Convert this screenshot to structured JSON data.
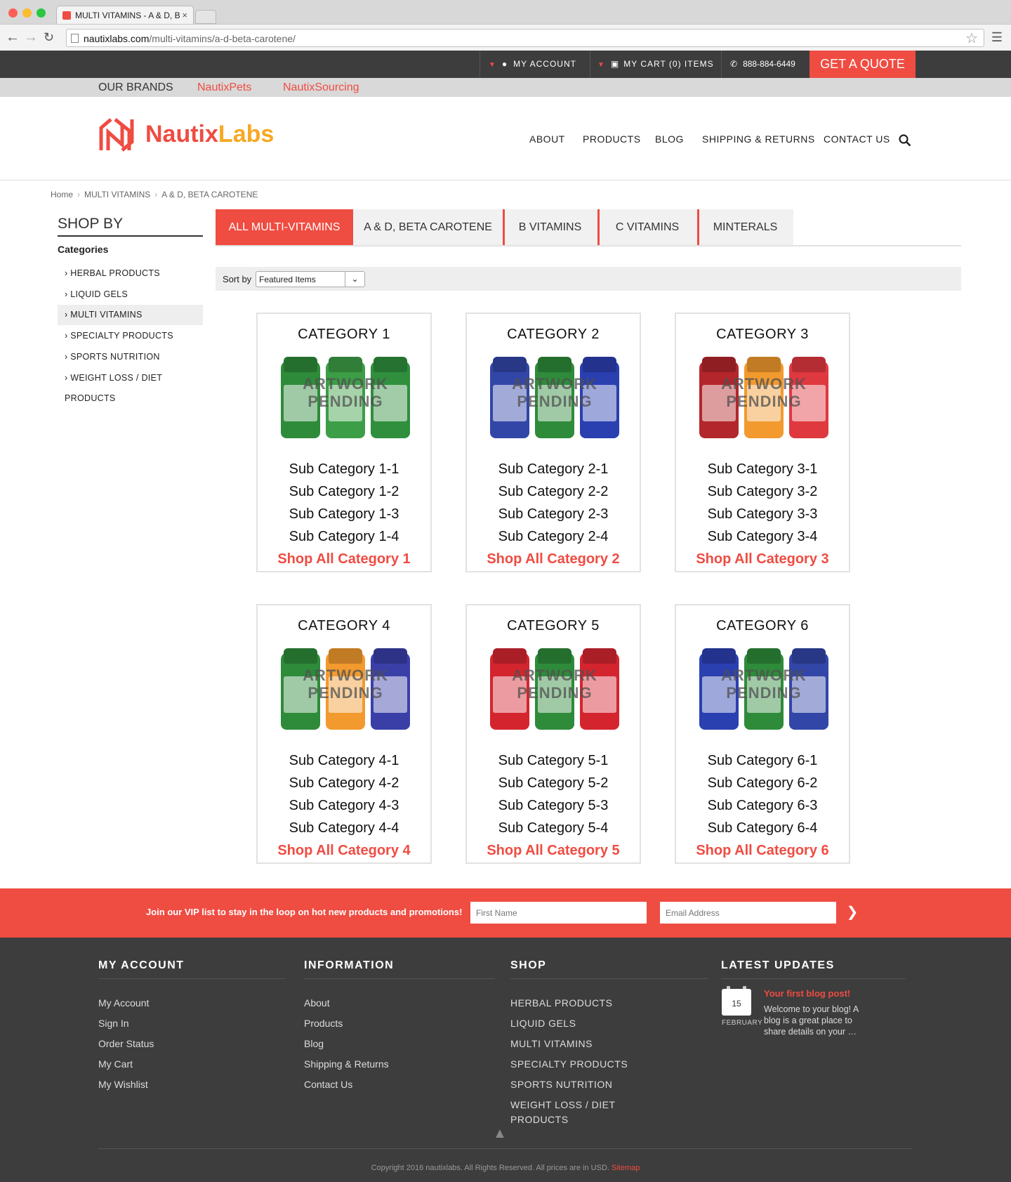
{
  "browser": {
    "tab_title": "MULTI VITAMINS - A & D, B",
    "tab_close": "×",
    "url_host": "nautixlabs.com",
    "url_path": "/multi-vitamins/a-d-beta-carotene/"
  },
  "topbar": {
    "account": "MY ACCOUNT",
    "cart": "MY CART (0) ITEMS",
    "phone": "888-884-6449",
    "quote": "GET A QUOTE"
  },
  "brands": {
    "label": "OUR BRANDS",
    "links": [
      "NautixPets",
      "NautixSourcing"
    ]
  },
  "logo": {
    "part1": "Nautix",
    "part2": "Labs"
  },
  "nav": [
    "ABOUT",
    "PRODUCTS",
    "BLOG",
    "SHIPPING & RETURNS",
    "CONTACT US"
  ],
  "breadcrumb": [
    "Home",
    "MULTI VITAMINS",
    "A & D, BETA CAROTENE"
  ],
  "sidebar": {
    "title": "SHOP BY",
    "heading": "Categories",
    "items": [
      "HERBAL PRODUCTS",
      "LIQUID GELS",
      "MULTI VITAMINS",
      "SPECIALTY PRODUCTS",
      "SPORTS NUTRITION",
      "WEIGHT LOSS / DIET PRODUCTS"
    ]
  },
  "tabs": [
    "ALL MULTI-VITAMINS",
    "A & D, BETA CAROTENE",
    "B VITAMINS",
    "C VITAMINS",
    "MINTERALS"
  ],
  "sort": {
    "label": "Sort by",
    "selected": "Featured Items"
  },
  "artwork_label": [
    "ARTWORK",
    "PENDING"
  ],
  "cards": [
    {
      "title": "CATEGORY 1",
      "subs": [
        "Sub Category 1-1",
        "Sub Category 1-2",
        "Sub Category 1-3",
        "Sub Category 1-4"
      ],
      "shop_all": "Shop All Category 1",
      "colors": [
        "#2e8b3a",
        "#3c9e46",
        "#2f8f3d"
      ]
    },
    {
      "title": "CATEGORY 2",
      "subs": [
        "Sub Category 2-1",
        "Sub Category 2-2",
        "Sub Category 2-3",
        "Sub Category 2-4"
      ],
      "shop_all": "Shop All Category 2",
      "colors": [
        "#3246a8",
        "#2e8b3a",
        "#2a3fb0"
      ]
    },
    {
      "title": "CATEGORY 3",
      "subs": [
        "Sub Category 3-1",
        "Sub Category 3-2",
        "Sub Category 3-3",
        "Sub Category 3-4"
      ],
      "shop_all": "Shop All Category 3",
      "colors": [
        "#b3262b",
        "#f29a2e",
        "#e0383f"
      ]
    },
    {
      "title": "CATEGORY 4",
      "subs": [
        "Sub Category 4-1",
        "Sub Category 4-2",
        "Sub Category 4-3",
        "Sub Category 4-4"
      ],
      "shop_all": "Shop All Category 4",
      "colors": [
        "#2e8b3a",
        "#f29a2e",
        "#3a3fa8"
      ]
    },
    {
      "title": "CATEGORY 5",
      "subs": [
        "Sub Category 5-1",
        "Sub Category 5-2",
        "Sub Category 5-3",
        "Sub Category 5-4"
      ],
      "shop_all": "Shop All Category 5",
      "colors": [
        "#d4252f",
        "#2e8b3a",
        "#d4252f"
      ]
    },
    {
      "title": "CATEGORY 6",
      "subs": [
        "Sub Category 6-1",
        "Sub Category 6-2",
        "Sub Category 6-3",
        "Sub Category 6-4"
      ],
      "shop_all": "Shop All Category 6",
      "colors": [
        "#2a3fb0",
        "#2e8b3a",
        "#3246a8"
      ]
    }
  ],
  "vip": {
    "text": "Join our VIP list to stay in the loop on hot new products and promotions!",
    "first_name_placeholder": "First Name",
    "email_placeholder": "Email Address"
  },
  "footer": {
    "my_account": {
      "title": "MY ACCOUNT",
      "links": [
        "My Account",
        "Sign In",
        "Order Status",
        "My Cart",
        "My Wishlist"
      ]
    },
    "information": {
      "title": "INFORMATION",
      "links": [
        "About",
        "Products",
        "Blog",
        "Shipping & Returns",
        "Contact Us"
      ]
    },
    "shop": {
      "title": "SHOP",
      "links": [
        "HERBAL PRODUCTS",
        "LIQUID GELS",
        "MULTI VITAMINS",
        "SPECIALTY PRODUCTS",
        "SPORTS NUTRITION",
        "WEIGHT LOSS / DIET",
        "PRODUCTS"
      ]
    },
    "latest": {
      "title": "LATEST UPDATES",
      "day": "15",
      "month": "FEBRUARY",
      "post_title": "Your first blog post!",
      "excerpt": "Welcome to your blog! A blog is a great place to share details on your …"
    },
    "copyright": "Copyright 2016 nautixlabs. All Rights Reserved. All prices are in USD.",
    "sitemap": "Sitemap"
  },
  "colors": {
    "accent": "#ef4c42",
    "logo_orange": "#f7a823",
    "dark": "#3d3d3d"
  }
}
